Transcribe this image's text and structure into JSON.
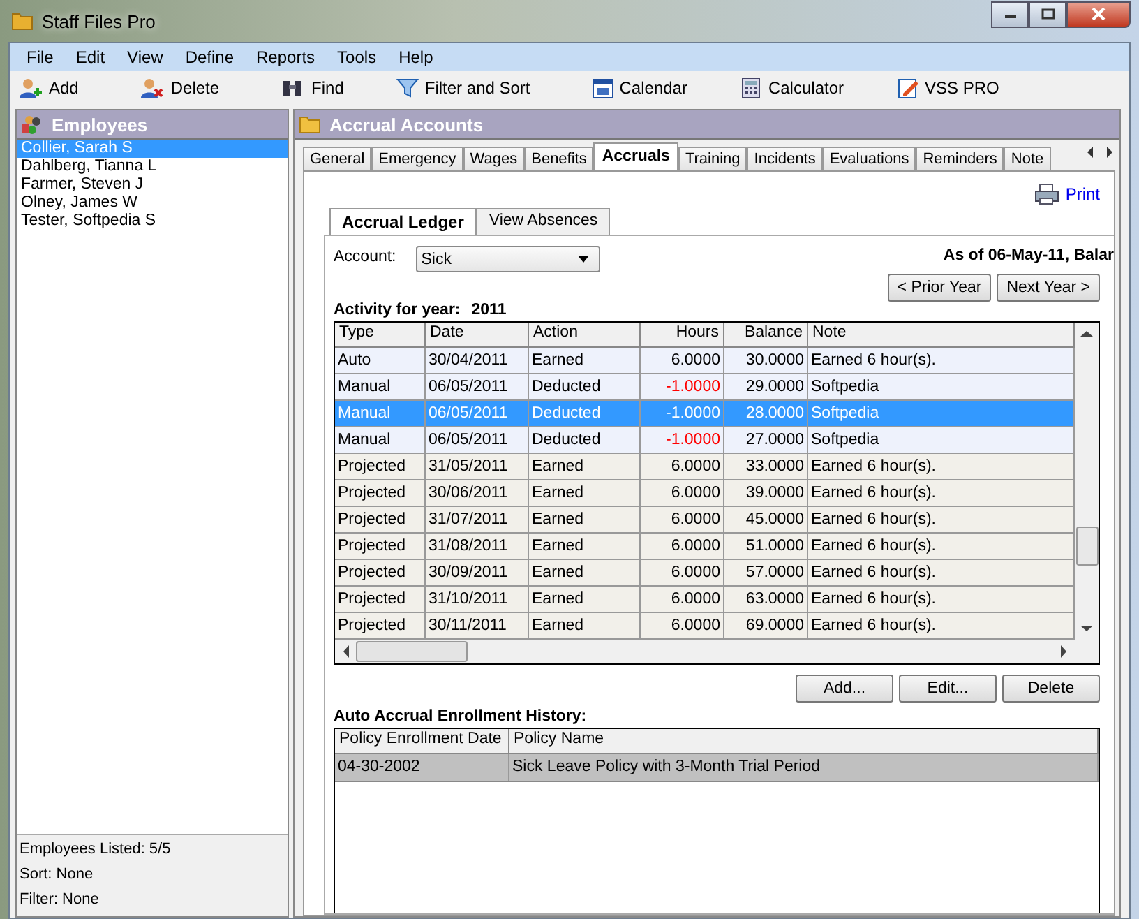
{
  "window": {
    "title": "Staff Files Pro"
  },
  "menu": [
    "File",
    "Edit",
    "View",
    "Define",
    "Reports",
    "Tools",
    "Help"
  ],
  "toolbar": [
    {
      "label": "Add",
      "kind": "add"
    },
    {
      "label": "Delete",
      "kind": "delete"
    },
    {
      "label": "Find",
      "kind": "find"
    },
    {
      "label": "Filter and Sort",
      "kind": "filter"
    },
    {
      "label": "Calendar",
      "kind": "calendar"
    },
    {
      "label": "Calculator",
      "kind": "calculator"
    },
    {
      "label": "VSS PRO",
      "kind": "vss"
    }
  ],
  "sidebar": {
    "title": "Employees",
    "items": [
      {
        "label": "Collier, Sarah S",
        "selected": true
      },
      {
        "label": "Dahlberg, Tianna L",
        "selected": false
      },
      {
        "label": "Farmer, Steven J",
        "selected": false
      },
      {
        "label": "Olney, James W",
        "selected": false
      },
      {
        "label": "Tester, Softpedia S",
        "selected": false
      }
    ],
    "status": [
      "Employees Listed: 5/5",
      "Sort: None",
      "Filter: None"
    ]
  },
  "panel": {
    "title": "Accrual Accounts",
    "tabs": [
      {
        "label": "General",
        "selected": false
      },
      {
        "label": "Emergency",
        "selected": false
      },
      {
        "label": "Wages",
        "selected": false
      },
      {
        "label": "Benefits",
        "selected": false
      },
      {
        "label": "Accruals",
        "selected": true
      },
      {
        "label": "Training",
        "selected": false
      },
      {
        "label": "Incidents",
        "selected": false
      },
      {
        "label": "Evaluations",
        "selected": false
      },
      {
        "label": "Reminders",
        "selected": false
      },
      {
        "label": "Note",
        "selected": false
      }
    ],
    "print": "Print",
    "subtabs": [
      {
        "label": "Accrual Ledger",
        "selected": true
      },
      {
        "label": "View Absences",
        "selected": false
      }
    ],
    "account_label": "Account:",
    "account_value": "Sick",
    "as_of": "As of 06-May-11, Balar",
    "prior_year": "< Prior Year",
    "next_year": "Next Year >",
    "activity_label": "Activity for year:",
    "activity_year": "2011",
    "table": {
      "columns": [
        "Type",
        "Date",
        "Action",
        "Hours",
        "Balance",
        "Note"
      ],
      "rows": [
        {
          "cells": [
            "Auto",
            "30/04/2011",
            "Earned",
            "6.0000",
            "30.0000",
            "Earned 6 hour(s)."
          ],
          "kind": "actual",
          "negative": false,
          "selected": false
        },
        {
          "cells": [
            "Manual",
            "06/05/2011",
            "Deducted",
            "-1.0000",
            "29.0000",
            "Softpedia"
          ],
          "kind": "actual",
          "negative": true,
          "selected": false
        },
        {
          "cells": [
            "Manual",
            "06/05/2011",
            "Deducted",
            "-1.0000",
            "28.0000",
            "Softpedia"
          ],
          "kind": "actual",
          "negative": true,
          "selected": true
        },
        {
          "cells": [
            "Manual",
            "06/05/2011",
            "Deducted",
            "-1.0000",
            "27.0000",
            "Softpedia"
          ],
          "kind": "actual",
          "negative": true,
          "selected": false
        },
        {
          "cells": [
            "Projected",
            "31/05/2011",
            "Earned",
            "6.0000",
            "33.0000",
            "Earned 6 hour(s)."
          ],
          "kind": "projected",
          "negative": false,
          "selected": false
        },
        {
          "cells": [
            "Projected",
            "30/06/2011",
            "Earned",
            "6.0000",
            "39.0000",
            "Earned 6 hour(s)."
          ],
          "kind": "projected",
          "negative": false,
          "selected": false
        },
        {
          "cells": [
            "Projected",
            "31/07/2011",
            "Earned",
            "6.0000",
            "45.0000",
            "Earned 6 hour(s)."
          ],
          "kind": "projected",
          "negative": false,
          "selected": false
        },
        {
          "cells": [
            "Projected",
            "31/08/2011",
            "Earned",
            "6.0000",
            "51.0000",
            "Earned 6 hour(s)."
          ],
          "kind": "projected",
          "negative": false,
          "selected": false
        },
        {
          "cells": [
            "Projected",
            "30/09/2011",
            "Earned",
            "6.0000",
            "57.0000",
            "Earned 6 hour(s)."
          ],
          "kind": "projected",
          "negative": false,
          "selected": false
        },
        {
          "cells": [
            "Projected",
            "31/10/2011",
            "Earned",
            "6.0000",
            "63.0000",
            "Earned 6 hour(s)."
          ],
          "kind": "projected",
          "negative": false,
          "selected": false
        },
        {
          "cells": [
            "Projected",
            "30/11/2011",
            "Earned",
            "6.0000",
            "69.0000",
            "Earned 6 hour(s)."
          ],
          "kind": "projected",
          "negative": false,
          "selected": false
        }
      ]
    },
    "buttons": [
      "Add...",
      "Edit...",
      "Delete"
    ],
    "history_label": "Auto Accrual Enrollment History:",
    "history": {
      "columns": [
        "Policy Enrollment Date",
        "Policy Name"
      ],
      "rows": [
        {
          "cells": [
            "04-30-2002",
            "Sick Leave Policy with 3-Month Trial Period"
          ],
          "selected": true
        }
      ]
    }
  }
}
